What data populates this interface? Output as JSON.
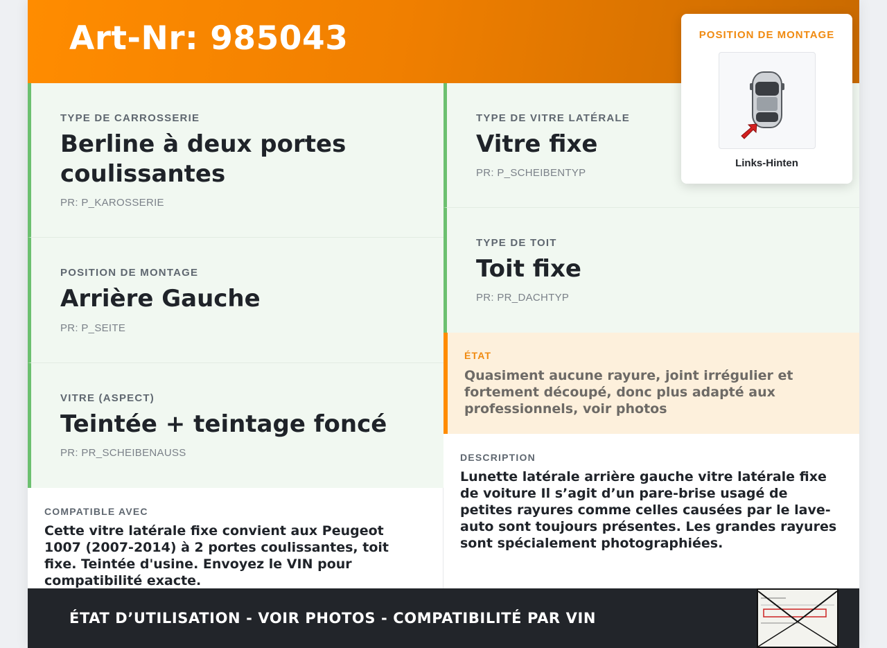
{
  "header": {
    "title": "Art-Nr: 985043"
  },
  "mount_card": {
    "label": "POSITION DE MONTAGE",
    "caption": "Links-Hinten",
    "image_icon": "car-top-view-icon"
  },
  "left_cells": [
    {
      "label": "TYPE DE CARROSSERIE",
      "value": "Berline à deux portes coulissantes",
      "pr": "PR: P_KAROSSERIE"
    },
    {
      "label": "POSITION DE MONTAGE",
      "value": "Arrière Gauche",
      "pr": "PR: P_SEITE"
    },
    {
      "label": "VITRE (ASPECT)",
      "value": "Teintée + teintage foncé",
      "pr": "PR: PR_SCHEIBENAUSS"
    }
  ],
  "right_cells": [
    {
      "label": "TYPE DE VITRE LATÉRALE",
      "value": "Vitre fixe",
      "pr": "PR: P_SCHEIBENTYP"
    },
    {
      "label": "TYPE DE TOIT",
      "value": "Toit fixe",
      "pr": "PR: PR_DACHTYP"
    }
  ],
  "etat": {
    "label": "ÉTAT",
    "text": "Quasiment aucune rayure, joint irrégulier et fortement découpé, donc plus adapté aux professionnels, voir photos"
  },
  "compatible": {
    "label": "COMPATIBLE AVEC",
    "text": "Cette vitre latérale fixe convient aux Peugeot 1007 (2007-2014) à 2 portes coulissantes, toit fixe. Teintée d'usine. Envoyez le VIN pour compatibilité exacte."
  },
  "description": {
    "label": "DESCRIPTION",
    "text": "Lunette latérale arrière gauche vitre latérale fixe de voiture Il s’agit d’un pare-brise usagé de petites rayures comme celles causées par le lave-auto sont toujours présentes. Les grandes rayures sont spécialement photographiées."
  },
  "footer": {
    "text": "ÉTAT D’UTILISATION - VOIR PHOTOS - COMPATIBILITÉ PAR VIN",
    "stamp_icon": "vehicle-document-stamp-icon"
  },
  "colors": {
    "accent": "#ff8c00",
    "green_border": "#6cc070",
    "cell_bg": "#f1f8f1",
    "etat_bg": "#fdf0dc",
    "footer_bg": "#22252a"
  }
}
